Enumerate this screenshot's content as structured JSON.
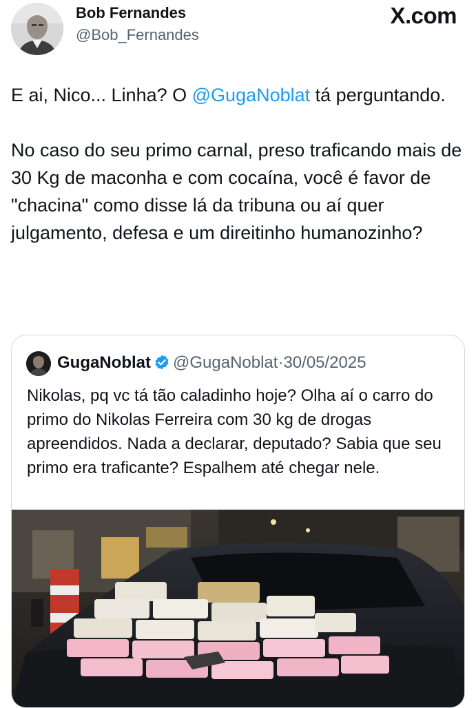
{
  "post": {
    "author_name": "Bob Fernandes",
    "author_handle": "@Bob_Fernandes",
    "brand": "X.com",
    "text_p1_a": "E ai, Nico... Linha? O ",
    "text_p1_mention": "@GugaNoblat",
    "text_p1_b": " tá perguntando.",
    "text_p2": "No caso do seu primo carnal, preso traficando mais de 30 Kg de maconha e com cocaína, você é favor de \"chacina\" como disse lá da tribuna ou aí quer julgamento, defesa e um direitinho humanozinho?"
  },
  "quote": {
    "author_name": "GugaNoblat",
    "author_handle": "@GugaNoblat",
    "separator": "·",
    "date": "30/05/2025",
    "text": "Nikolas, pq vc tá tão caladinho hoje? Olha aí o carro do primo do Nikolas Ferreira com 30 kg de drogas apreendidos. Nada a declarar, deputado? Sabia que seu primo era traficante? Espalhem até chegar nele."
  },
  "colors": {
    "accent": "#1d9bf0",
    "text": "#0f1419",
    "muted": "#536471",
    "border": "#cfd9de"
  },
  "icons": {
    "verified": "verified-badge-icon"
  }
}
